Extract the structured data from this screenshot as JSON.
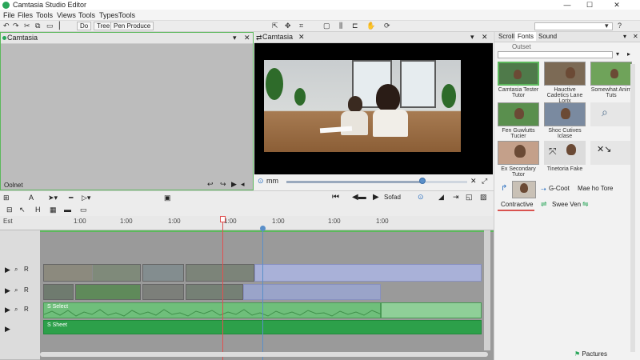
{
  "window": {
    "title": "Camtasia Studio Editor",
    "controls": [
      "—",
      "☐",
      "✕"
    ]
  },
  "menu": [
    "File",
    "Files",
    "Tools",
    "Views",
    "Tools",
    "Types",
    "Tools"
  ],
  "toolbar": {
    "undo_label": "Do",
    "paste_label": "Tree",
    "share_label": "Pen Produce"
  },
  "left_panel": {
    "title": "Camtasia",
    "status": "Oolnet"
  },
  "preview_panel": {
    "title": "Camtasia",
    "time_label": "mm",
    "audio_label": "Sofad"
  },
  "media_panel": {
    "tabs": [
      "Scroll",
      "Fonts",
      "Sound"
    ],
    "search_label": "Outset",
    "thumbs": [
      {
        "caption": "Camtasia Tester Tutor",
        "bg": "#4f7a4a"
      },
      {
        "caption": "Hauctive Cadetics Lane Lorix",
        "bg": "#7c6a55"
      },
      {
        "caption": "Somewhat Anim Tuts",
        "bg": "#6fa35a"
      },
      {
        "caption": "Fen Guwlutts Tucier",
        "bg": "#5a8f4e"
      },
      {
        "caption": "Shoc Cutives Iclase",
        "bg": "#7a8aa0"
      },
      {
        "caption": "",
        "bg": "#e6e6e6"
      },
      {
        "caption": "Ex Secondary Tutor",
        "bg": "#c4a08a"
      },
      {
        "caption": "Tinetoria Fake",
        "bg": "#dcdcdc"
      },
      {
        "caption": "",
        "bg": "#e6e6e6"
      }
    ],
    "rows": [
      {
        "left": "",
        "a": "G-Coot",
        "b": "Mae ho Tore"
      },
      {
        "left": "Contractive",
        "a": "Swee Ven",
        "b": ""
      }
    ],
    "footer": "Pactures"
  },
  "timeline": {
    "track_label": "Est",
    "ruler_ticks": [
      "1:00",
      "1:00",
      "1:00",
      "1:00",
      "1:00",
      "1:00",
      "1:00"
    ],
    "audio_label": "S Select",
    "audio2_label": "S Sheet"
  },
  "colors": {
    "accent": "#5cb85c",
    "clip_blue": "#a9b1d8",
    "audio_green": "#6fbf7b",
    "audio_dark": "#2da04a"
  }
}
